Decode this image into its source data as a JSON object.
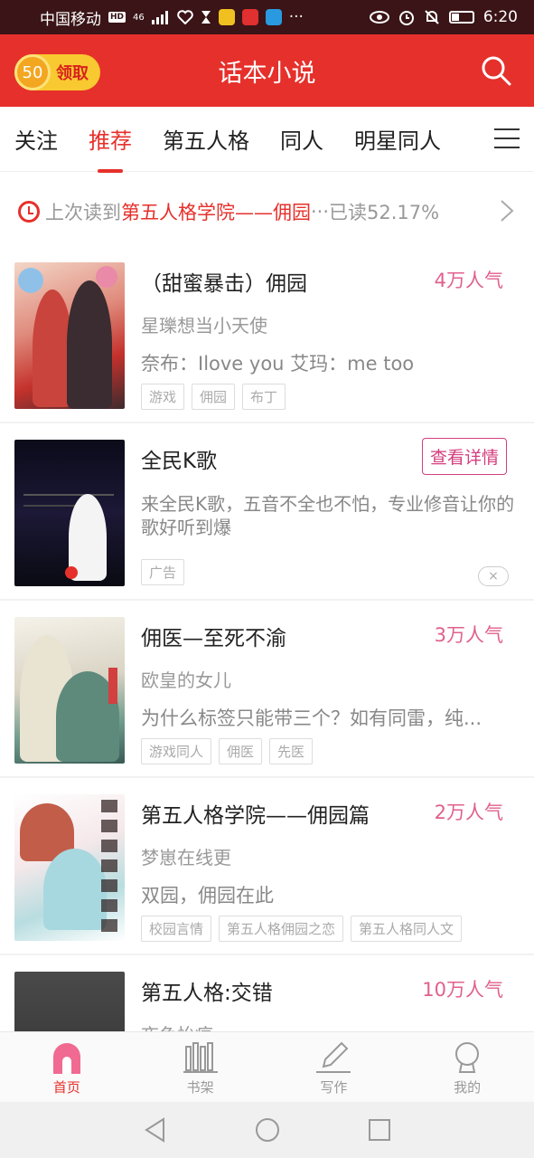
{
  "status_bar": {
    "carrier": "中国移动",
    "hd": "HD",
    "signal": "46",
    "time": "6:20"
  },
  "app_bar": {
    "coins": "50",
    "claim_label": "领取",
    "title": "话本小说"
  },
  "tabs": [
    {
      "label": "关注"
    },
    {
      "label": "推荐"
    },
    {
      "label": "第五人格"
    },
    {
      "label": "同人"
    },
    {
      "label": "明星同人"
    }
  ],
  "recent": {
    "prefix": "上次读到",
    "book": "第五人格学院——佣园",
    "ellipsis": "···",
    "suffix": "已读52.17%"
  },
  "books": [
    {
      "title": "（甜蜜暴击）佣园",
      "popularity": "4万人气",
      "author": "星瓅想当小天使",
      "desc": "奈布：Ilove you 艾玛：me too",
      "tags": [
        "游戏",
        "佣园",
        "布丁"
      ]
    },
    {
      "title": "佣医—至死不渝",
      "popularity": "3万人气",
      "author": "欧皇的女儿",
      "desc": "为什么标签只能带三个？如有同雷，纯...",
      "tags": [
        "游戏同人",
        "佣医",
        "先医"
      ]
    },
    {
      "title": "第五人格学院——佣园篇",
      "popularity": "2万人气",
      "author": "梦崽在线更",
      "desc": "双园，佣园在此",
      "tags": [
        "校园言情",
        "第五人格佣园之恋",
        "第五人格同人文"
      ]
    },
    {
      "title": "第五人格:交错",
      "popularity": "10万人气",
      "author": "夜色怡痕"
    }
  ],
  "ad": {
    "title": "全民K歌",
    "detail_label": "查看详情",
    "desc": "来全民K歌，五音不全也不怕，专业修音让你的歌好听到爆",
    "tag": "广告",
    "close": "×"
  },
  "bottom_nav": [
    {
      "label": "首页"
    },
    {
      "label": "书架"
    },
    {
      "label": "写作"
    },
    {
      "label": "我的"
    }
  ],
  "colors": {
    "brand_red": "#e6302b",
    "popularity_pink": "#e0608e"
  }
}
